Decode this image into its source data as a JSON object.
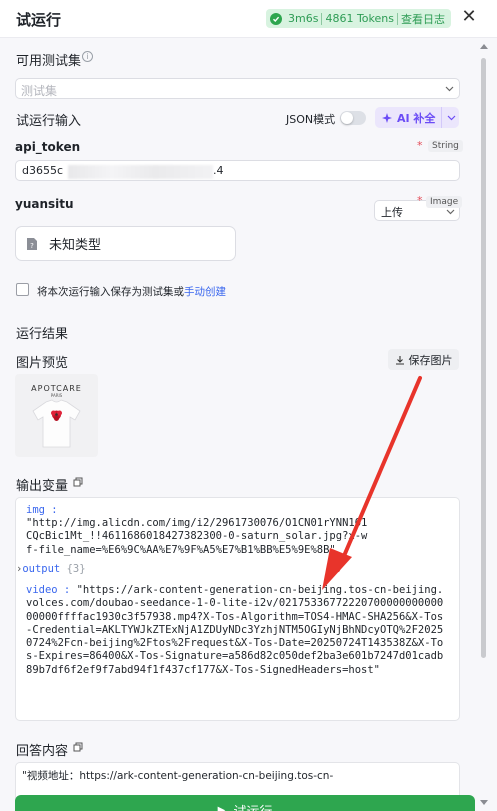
{
  "header": {
    "title": "试运行",
    "status_duration": "3m6s",
    "status_tokens": "4861 Tokens",
    "status_link": "查看日志",
    "close_symbol": "✕"
  },
  "testset": {
    "label": "可用测试集",
    "placeholder": "测试集"
  },
  "input": {
    "label": "试运行输入",
    "json_mode_label": "JSON模式",
    "ai_button": "AI 补全",
    "params": [
      {
        "name": "api_token",
        "type": "String",
        "required_mark": "*",
        "value_start": "d3655c",
        "value_end": ".4"
      },
      {
        "name": "yuansitu",
        "type": "Image",
        "required_mark": "*",
        "select_value": "上传",
        "upload_label": "未知类型"
      }
    ],
    "save_checkbox_label": "将本次运行输入保存为测试集或",
    "save_checkbox_link": "手动创建"
  },
  "result": {
    "label": "运行结果",
    "image_preview_label": "图片预览",
    "save_image_button": "保存图片",
    "thumbnail_brand": "APOTCARE",
    "thumbnail_sub": "PARIS",
    "output_vars_label": "输出变量",
    "output_vars": {
      "img_key": "img",
      "img_value": "\"http://img.alicdn.com/img/i2/2961730076/O1CN01rYNN1O1CQcBic1Mt_!!4611686018427382300-0-saturn_solar.jpg?x-wf-file_name=%E6%9C%AA%E7%9F%A5%E7%B1%BB%E5%9E%8B\"",
      "output_key": "output",
      "output_count": "{3}",
      "video_key": "video",
      "video_value": "\"https://ark-content-generation-cn-beijing.tos-cn-beijing.volces.com/doubao-seedance-1-0-lite-i2v/0217533677222070000000000000000ffffac1930c3f57938.mp4?X-Tos-Algorithm=TOS4-HMAC-SHA256&X-Tos-Credential=AKLTYWJkZTExNjA1ZDUyNDc3YzhjNTM5OGIyNjBhNDcyOTQ%2F20250724%2Fcn-beijing%2Ftos%2Frequest&X-Tos-Date=20250724T143538Z&X-Tos-Expires=86400&X-Tos-Signature=a586d82c050def2ba3e601b7247d01cadb89b7df6f2ef9f7abd94f1f437cf177&X-Tos-SignedHeaders=host\""
    },
    "answer_label": "回答内容",
    "answer_text": "\"视频地址：https://ark-content-generation-cn-beijing.tos-cn-"
  },
  "footer": {
    "run_button": "试运行",
    "run_icon": "▶"
  },
  "colors": {
    "accent_green": "#2ea64f",
    "link_blue": "#3a67ee",
    "ai_purple": "#6b4cf6",
    "arrow_red": "#e8342b"
  }
}
